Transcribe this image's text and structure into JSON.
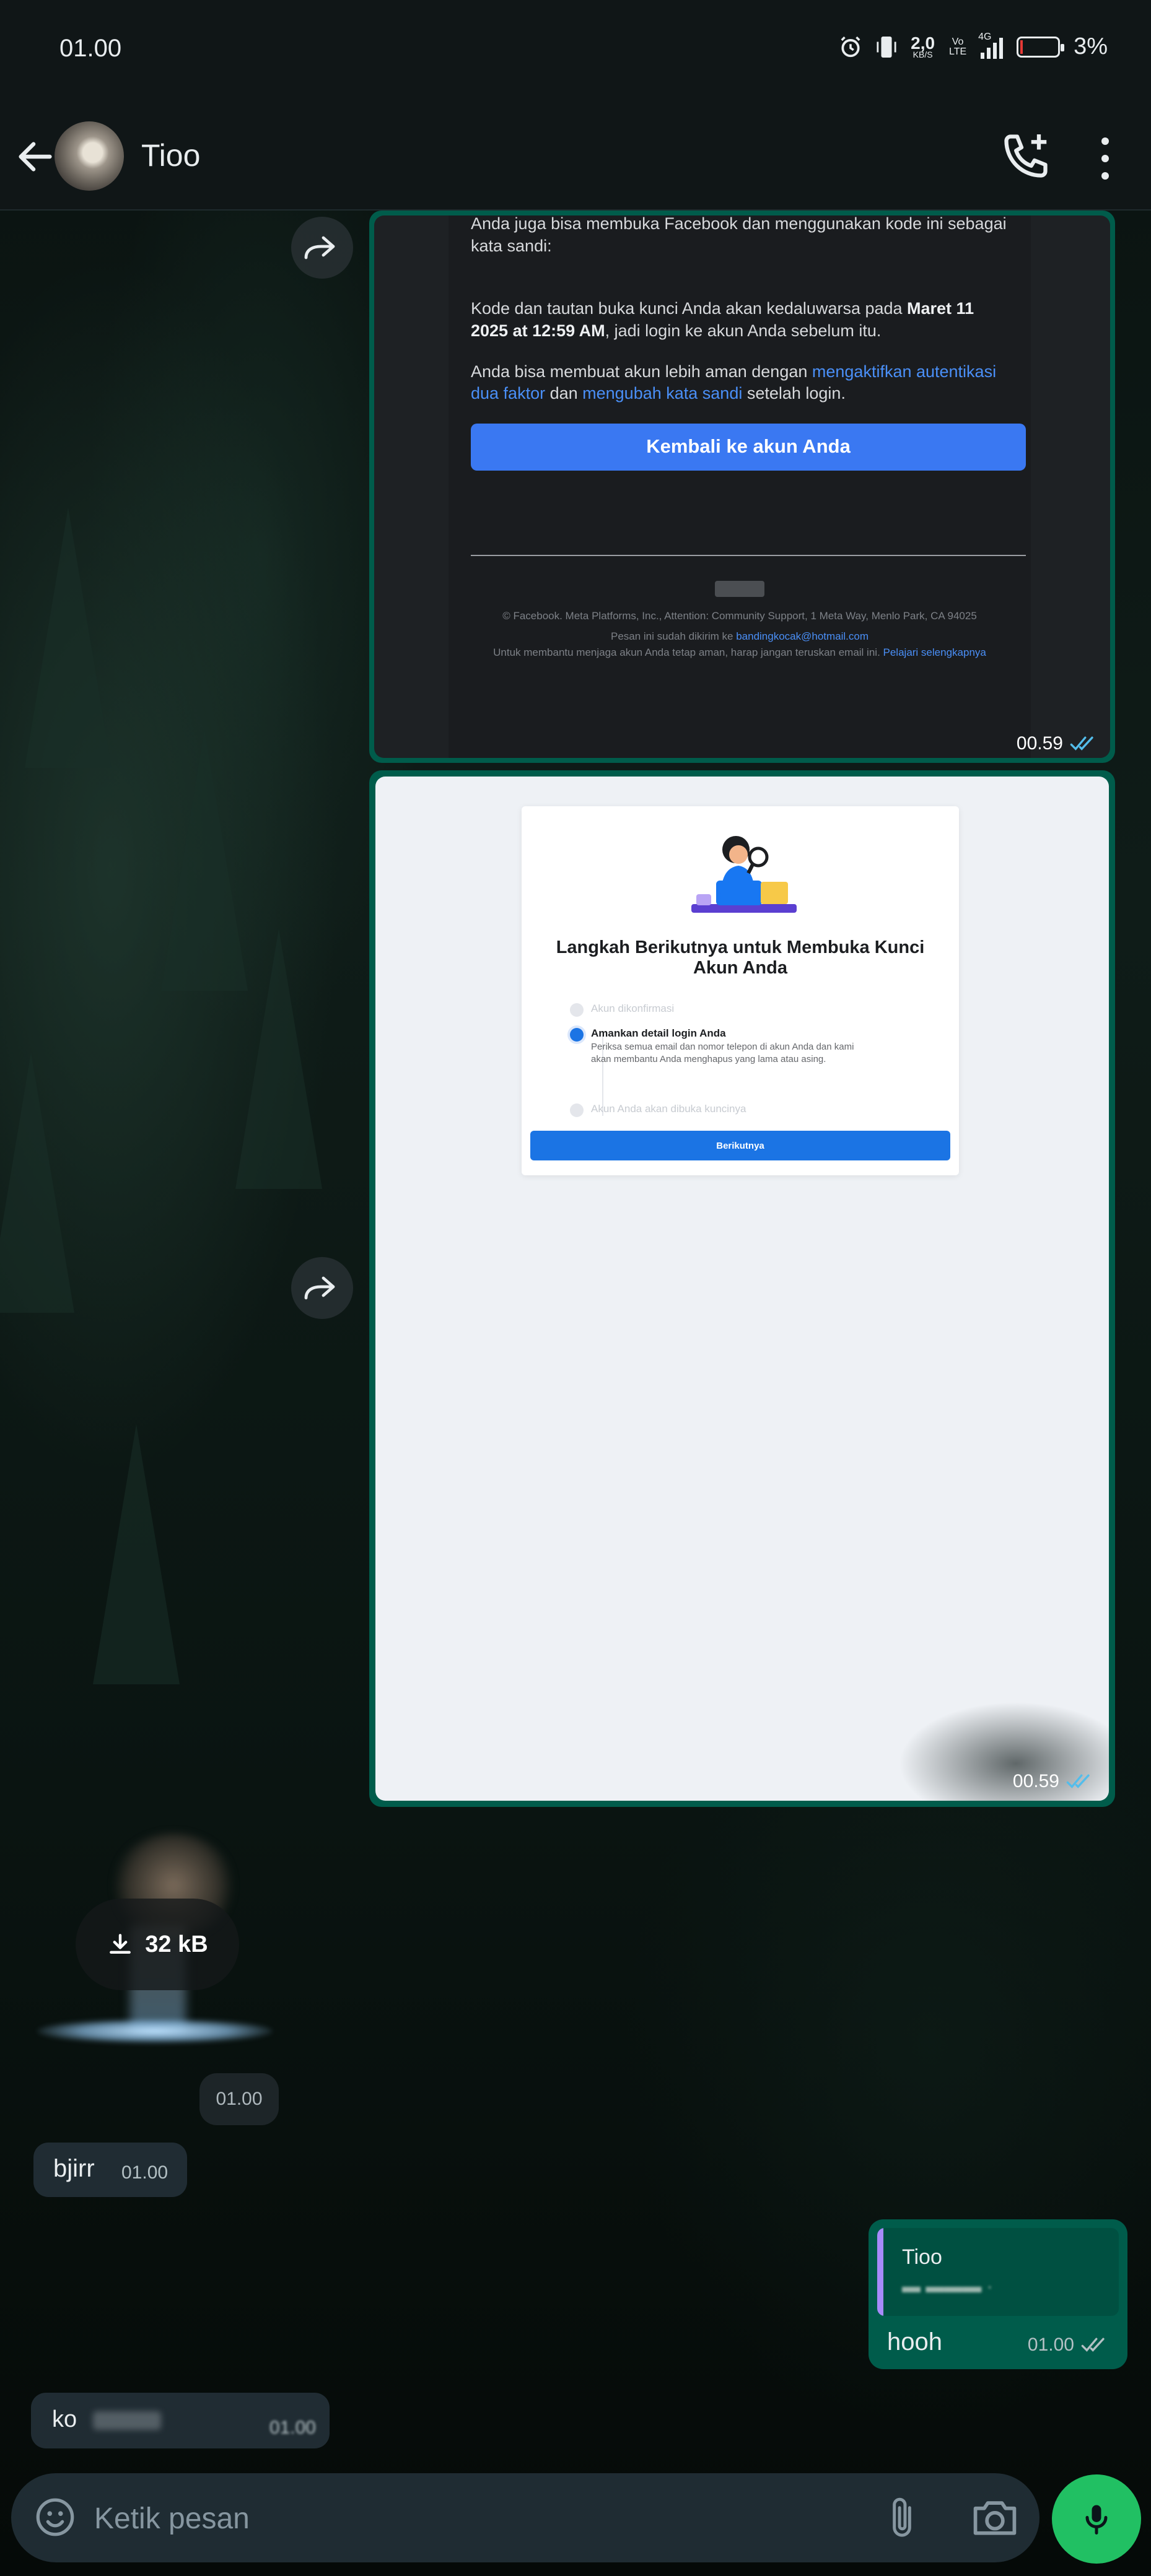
{
  "status_bar": {
    "time": "01.00",
    "net_speed": "2,0",
    "net_unit": "KB/S",
    "volte": "Vo LTE",
    "signal": "4G",
    "battery": "3%",
    "battery_level": 0.03
  },
  "header": {
    "contact_name": "Tioo"
  },
  "messages": {
    "image1": {
      "email_intro": "Anda juga bisa membuka Facebook dan menggunakan kode ini sebagai kata sandi:",
      "expiry_a": "Kode dan tautan buka kunci Anda akan kedaluwarsa pada ",
      "expiry_date": "Maret 11 2025 at 12:59 AM",
      "expiry_b": ", jadi login ke akun Anda sebelum itu.",
      "secure_a": "Anda bisa membuat akun lebih aman dengan ",
      "secure_link1": "mengaktifkan autentikasi dua faktor",
      "secure_mid": " dan ",
      "secure_link2": "mengubah kata sandi",
      "secure_b": " setelah login.",
      "button": "Kembali ke akun Anda",
      "footer1": "© Facebook. Meta Platforms, Inc., Attention: Community Support, 1 Meta Way, Menlo Park, CA 94025",
      "footer2_a": "Pesan ini sudah dikirim ke ",
      "footer2_email": "bandingkocak@hotmail.com",
      "footer3": "Untuk membantu menjaga akun Anda tetap aman, harap jangan teruskan email ini. ",
      "footer3_link": "Pelajari selengkapnya",
      "time": "00.59"
    },
    "image2": {
      "title": "Langkah Berikutnya untuk Membuka Kunci Akun Anda",
      "step1": "Akun dikonfirmasi",
      "step2_title": "Amankan detail login Anda",
      "step2_desc": "Periksa semua email dan nomor telepon di akun Anda dan kami akan membantu Anda menghapus yang lama atau asing.",
      "step3": "Akun Anda akan dibuka kuncinya",
      "button": "Berikutnya",
      "time": "00.59"
    },
    "file": {
      "size": "32 kB",
      "time": "01.00"
    },
    "msg_bjirr": {
      "text": "bjirr",
      "time": "01.00"
    },
    "msg_hooh": {
      "quote_name": "Tioo",
      "text": "hooh",
      "time": "01.00"
    },
    "msg_ko": {
      "text": "ko",
      "time": "01.00"
    }
  },
  "input": {
    "placeholder": "Ketik pesan"
  },
  "colors": {
    "outgoing_bubble": "#005c4b",
    "incoming_bubble": "#202c33",
    "read_ticks": "#53bdeb",
    "mic_button": "#21c063",
    "fb_blue": "#3a78f2"
  }
}
